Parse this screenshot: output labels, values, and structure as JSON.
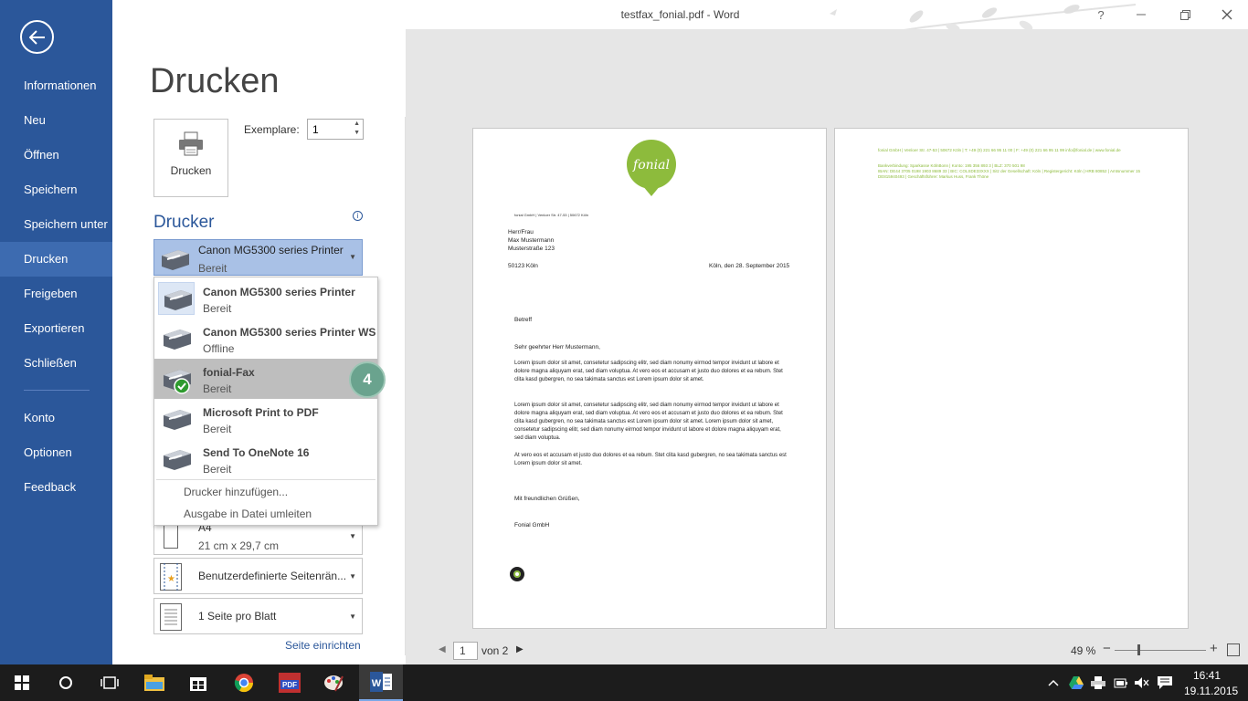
{
  "window": {
    "title": "testfax_fonial.pdf - Word",
    "help": "?"
  },
  "sidebar": {
    "items": [
      {
        "label": "Informationen"
      },
      {
        "label": "Neu"
      },
      {
        "label": "Öffnen"
      },
      {
        "label": "Speichern"
      },
      {
        "label": "Speichern unter"
      },
      {
        "label": "Drucken"
      },
      {
        "label": "Freigeben"
      },
      {
        "label": "Exportieren"
      },
      {
        "label": "Schließen"
      },
      {
        "label": "Konto"
      },
      {
        "label": "Optionen"
      },
      {
        "label": "Feedback"
      }
    ]
  },
  "print": {
    "title": "Drucken",
    "button_label": "Drucken",
    "copies_label": "Exemplare:",
    "copies_value": "1",
    "printer_heading": "Drucker",
    "selected_printer": {
      "name": "Canon MG5300 series Printer",
      "status": "Bereit"
    }
  },
  "printer_list": [
    {
      "name": "Canon MG5300 series Printer",
      "status": "Bereit"
    },
    {
      "name": "Canon MG5300 series Printer WS",
      "status": "Offline"
    },
    {
      "name": "fonial-Fax",
      "status": "Bereit"
    },
    {
      "name": "Microsoft Print to PDF",
      "status": "Bereit"
    },
    {
      "name": "Send To OneNote 16",
      "status": "Bereit"
    }
  ],
  "printer_actions": {
    "add": "Drucker hinzufügen...",
    "to_file": "Ausgabe in Datei umleiten"
  },
  "step_badge": "4",
  "settings": {
    "paper": {
      "title": "A4",
      "detail": "21 cm x 29,7 cm"
    },
    "margins": {
      "title": "Benutzerdefinierte Seitenrän..."
    },
    "pages_per_sheet": {
      "title": "1 Seite pro Blatt"
    },
    "page_setup_link": "Seite einrichten"
  },
  "preview": {
    "page_number": "1",
    "page_total": "von 2",
    "zoom": "49 %",
    "zoom_fraction": 0.25,
    "page1": {
      "logo_text": "fonial",
      "sender_line": "fonial GmbH | Venloer Str. 47-53 | 50672 Köln",
      "address": [
        "Herr/Frau",
        "Max Mustermann",
        "Musterstraße 123"
      ],
      "city": "50123 Köln",
      "date": "Köln, den 28. September 2015",
      "subject": "Betreff",
      "greeting": "Sehr geehrter Herr Mustermann,",
      "para1": "Lorem ipsum dolor sit amet, consetetur sadipscing elitr, sed diam nonumy eirmod tempor invidunt ut labore et dolore magna aliquyam erat, sed diam voluptua. At vero eos et accusam et justo duo dolores et ea rebum. Stet clita kasd gubergren, no sea takimata sanctus est Lorem ipsum dolor sit amet.",
      "para2": "Lorem ipsum dolor sit amet, consetetur sadipscing elitr, sed diam nonumy eirmod tempor invidunt ut labore et dolore magna aliquyam erat, sed diam voluptua. At vero eos et accusam et justo duo dolores et ea rebum. Stet clita kasd gubergren, no sea takimata sanctus est Lorem ipsum dolor sit amet. Lorem ipsum dolor sit amet, consetetur sadipscing elitr, sed diam nonumy eirmod tempor invidunt ut labore et dolore magna aliquyam erat, sed diam voluptua.",
      "para3": "At vero eos et accusam et justo duo dolores et ea rebum. Stet clita kasd gubergren, no sea takimata sanctus est Lorem ipsum dolor sit amet.",
      "closing": "Mit freundlichen Grüßen,",
      "signature": "Fonial GmbH"
    },
    "page2": {
      "footer_line1": "fonial GmbH | Venloer Str. 47-53 | 50672 Köln | T: +49 (0) 221 66 95 11 00 | F: +49 (0) 221 66 95 11 99 info@fonial.de | www.fonial.de",
      "footer_line2": "Bankverbindung: Sparkasse KölnBonn | Konto: 195 356 893 3 | BLZ: 370 501 98",
      "footer_line3": "IBAN: DE44 3705 0198 1903 8689 33 | BIC: COLSDE33XXX | Sitz der Gesellschaft: Köln | Registergericht: Köln | HRB 80852 | Amtsnummer 15",
      "footer_line4": "DE815940493 | Geschäftsführer: Markus Huss, Frank Thöne"
    }
  },
  "taskbar": {
    "time": "16:41",
    "date": "19.11.2015"
  },
  "colors": {
    "sidebar": "#2b579a",
    "accent": "#2b579a",
    "fonial_green": "#8dbb3c",
    "badge": "#6aa38e"
  }
}
